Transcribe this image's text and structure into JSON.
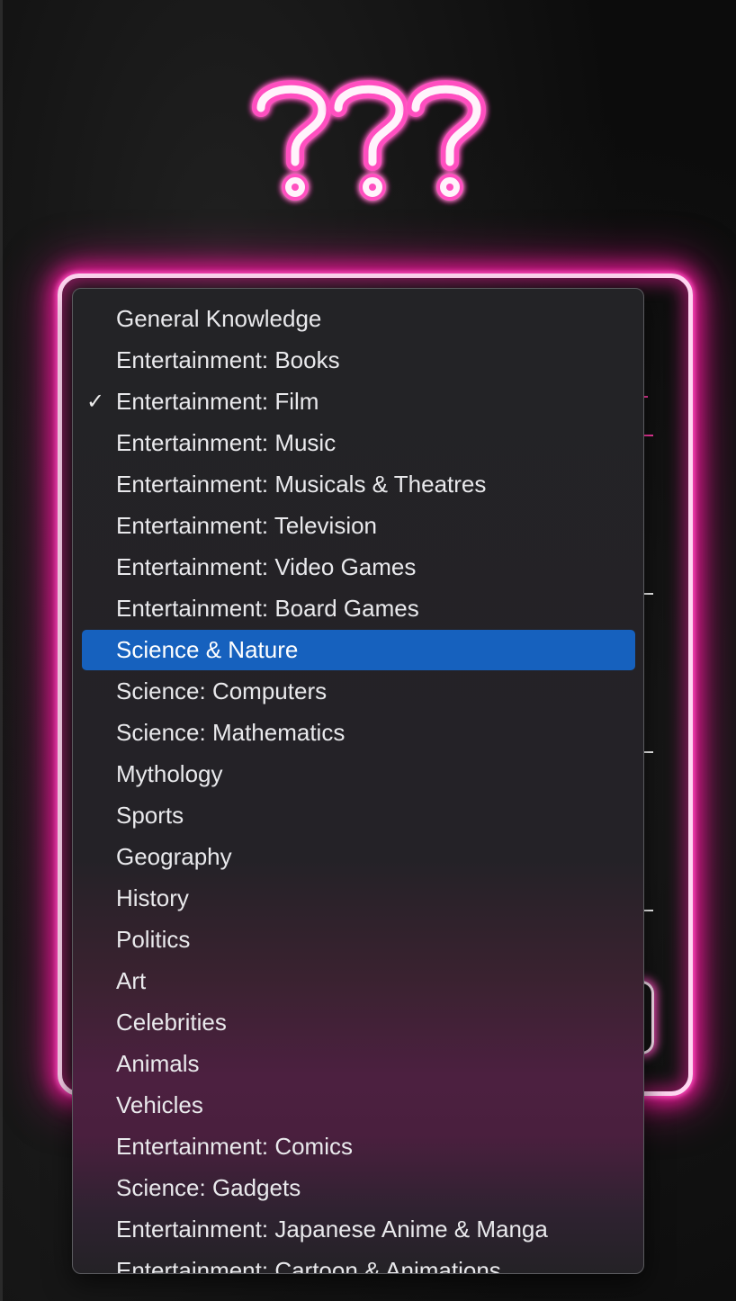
{
  "logo": {
    "glyphs": "???",
    "color": "#ff4fc0"
  },
  "frame": {
    "accent_color": "#e0198f"
  },
  "dropdown": {
    "selected_index": 2,
    "highlighted_index": 8,
    "highlight_color": "#1661be",
    "check_glyph": "✓",
    "options": [
      {
        "label": "General Knowledge"
      },
      {
        "label": "Entertainment: Books"
      },
      {
        "label": "Entertainment: Film"
      },
      {
        "label": "Entertainment: Music"
      },
      {
        "label": "Entertainment: Musicals & Theatres"
      },
      {
        "label": "Entertainment: Television"
      },
      {
        "label": "Entertainment: Video Games"
      },
      {
        "label": "Entertainment: Board Games"
      },
      {
        "label": "Science & Nature"
      },
      {
        "label": "Science: Computers"
      },
      {
        "label": "Science: Mathematics"
      },
      {
        "label": "Mythology"
      },
      {
        "label": "Sports"
      },
      {
        "label": "Geography"
      },
      {
        "label": "History"
      },
      {
        "label": "Politics"
      },
      {
        "label": "Art"
      },
      {
        "label": "Celebrities"
      },
      {
        "label": "Animals"
      },
      {
        "label": "Vehicles"
      },
      {
        "label": "Entertainment: Comics"
      },
      {
        "label": "Science: Gadgets"
      },
      {
        "label": "Entertainment: Japanese Anime & Manga"
      },
      {
        "label": "Entertainment: Cartoon & Animations"
      }
    ]
  }
}
